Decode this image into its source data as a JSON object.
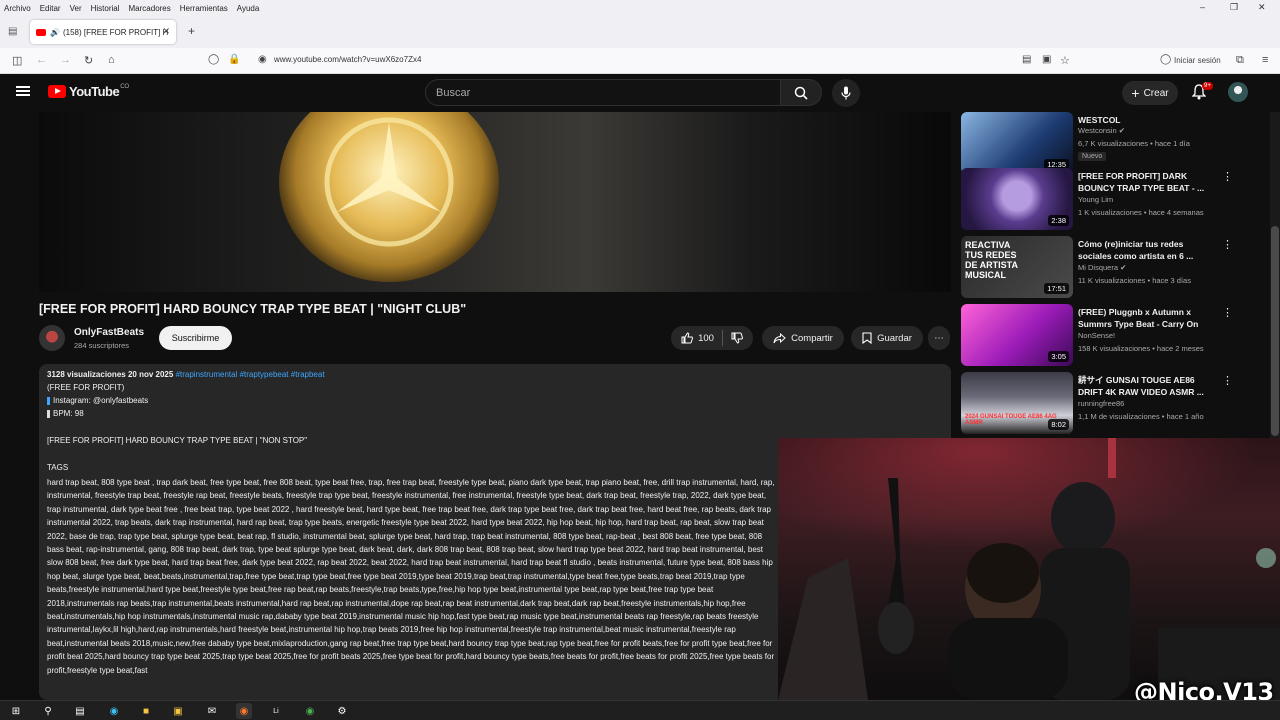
{
  "browser": {
    "menu": [
      "Archivo",
      "Editar",
      "Ver",
      "Historial",
      "Marcadores",
      "Herramientas",
      "Ayuda"
    ],
    "tab_title": "(158) [FREE FOR PROFIT] H",
    "url": "www.youtube.com/watch?v=uwX6zo7Zx4",
    "signin_label": "Iniciar sesión"
  },
  "youtube": {
    "logo": "YouTube",
    "logo_region": "CO",
    "search_placeholder": "Buscar",
    "create_label": "Crear",
    "notifications_badge": "9+"
  },
  "video": {
    "title": "[FREE FOR PROFIT] HARD BOUNCY TRAP TYPE BEAT | \"NIGHT CLUB\"",
    "channel": "OnlyFastBeats",
    "subscribers": "284 suscriptores",
    "subscribe_label": "Suscribirme",
    "likes": "100",
    "share_label": "Compartir",
    "save_label": "Guardar"
  },
  "description": {
    "views": "3128 visualizaciones",
    "date": "20 nov 2025",
    "hashtags": "#trapinstrumental #traptypebeat #trapbeat",
    "lines": [
      "(FREE FOR PROFIT)",
      "Instagram: @onlyfastbeats",
      "BPM: 98",
      "[FREE FOR PROFIT] HARD BOUNCY TRAP TYPE BEAT | \"NON STOP\"",
      "TAGS"
    ],
    "tags_text": "hard trap beat, 808 type beat , trap dark beat, free type beat, free 808 beat, type beat free, trap, free trap beat, freestyle type beat, piano dark type beat, trap piano beat, free, drill trap instrumental, hard, rap, instrumental, freestyle trap beat, freestyle rap beat, freestyle beats, freestyle trap type beat, freestyle instrumental, free instrumental, freestyle type beat, dark trap beat, freestyle trap, 2022, dark type beat, trap instrumental, dark type beat free , free beat trap, type beat 2022 , hard freestyle beat, hard type beat, free trap beat free, dark trap type beat free, dark trap beat free, hard beat free, rap beats, dark trap instrumental 2022, trap beats, dark trap instrumental, hard rap beat, trap type beats, energetic freestyle type beat 2022, hard type beat 2022, hip hop beat, hip hop, hard trap beat, rap beat, slow trap beat 2022, base de trap, trap type beat, splurge type beat, beat rap, fl studio, instrumental beat, splurge type beat, hard trap, trap beat instrumental, 808 type beat, rap-beat , best 808 beat, free type beat, 808 bass beat, rap-instrumental, gang, 808 trap beat, dark trap, type beat splurge type beat, dark beat, dark, dark 808 trap beat, 808 trap beat, slow hard trap type beat 2022, hard trap beat instrumental, best slow 808 beat, free dark type beat, hard trap beat free, dark type beat 2022, rap beat 2022, beat 2022, hard trap beat instrumental, hard trap beat fl studio , beats instrumental, future type beat, 808 bass hip hop beat, slurge type beat, beat,beats,instrumental,trap,free type beat,trap type beat,free type beat 2019,type beat 2019,trap beat,trap instrumental,type beat free,type beats,trap beat 2019,trap type beats,freestyle instrumental,hard type beat,freestyle type beat,free rap beat,rap beats,freestyle,trap beats,type,free,hip hop type beat,instrumental type beat,rap type beat,free trap type beat 2018,instrumentals rap beats,trap instrumental,beats instrumental,hard rap beat,rap instrumental,dope rap beat,rap beat instrumental,dark trap beat,dark rap beat,freestyle instrumentals,hip hop,free beat,instrumentals,hip hop instrumentals,instrumental music rap,dababy type beat 2019,instrumental music hip hop,fast type beat,rap music type beat,instrumental beats rap freestyle,rap beats freestyle instrumental,laykx,lil high,hard,rap instrumentals,hard freestyle beat,instrumental hip hop,trap beats 2019,free hip hop instrumental,freestyle trap instrumental,beat music instrumental,freestyle rap beat,instrumental beats 2018,music,new,free dababy type beat,mixlaproduction,gang rap beat,free trap type beat,hard bouncy trap type beat,rap type beat,free for profit beats,free for profit type beat,free for profit beat 2025,hard bouncy trap type beat 2025,trap type beat 2025,free for profit beats 2025,free type beat for profit,hard bouncy type beats,free beats for profit,free beats for profit 2025,free type beats for profit,freestyle type beat,fast"
  },
  "recommendations": [
    {
      "title": "WESTCOL",
      "channel": "Westconsin",
      "views": "6,7 K visualizaciones • hace 1 día",
      "duration": "12:35",
      "badge": "Nuevo"
    },
    {
      "title": "[FREE FOR PROFIT] DARK BOUNCY TRAP TYPE BEAT - ...",
      "channel": "Young Lim",
      "views": "1 K visualizaciones • hace 4 semanas",
      "duration": "2:38"
    },
    {
      "title": "Cómo (re)iniciar tus redes sociales como artista en 6 ...",
      "channel": "Mi Disquera",
      "views": "11 K visualizaciones • hace 3 días",
      "duration": "17:51",
      "thumb_text": "REACTIVA TUS REDES DE ARTISTA MUSICAL"
    },
    {
      "title": "(FREE) Pluggnb x Autumn x Summrs Type Beat - Carry On",
      "channel": "NonSense!",
      "views": "158 K visualizaciones • hace 2 meses",
      "duration": "3:05"
    },
    {
      "title": "耕サイ GUNSAI TOUGE AE86 DRIFT 4K RAW VIDEO ASMR ...",
      "channel": "runningfree86",
      "views": "1,1 M de visualizaciones • hace 1 año",
      "duration": "8:02",
      "thumb_text": "2024 GUNSAI TOUGE AE86 4AG ASMR"
    }
  ],
  "overlay": {
    "watermark": "@Nico.V13"
  },
  "colors": {
    "background": "#0f0f0f",
    "youtube_red": "#ff0000",
    "link_blue": "#3ea6ff",
    "panel": "#272727"
  }
}
